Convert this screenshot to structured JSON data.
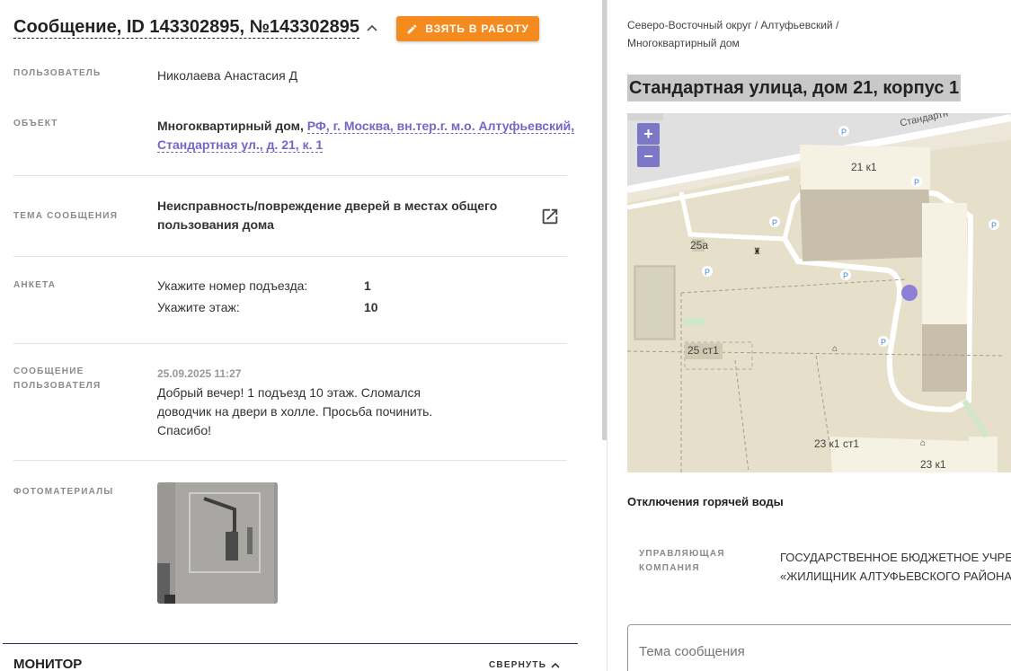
{
  "header": {
    "title": "Сообщение, ID 143302895, №143302895",
    "take_button_label": "ВЗЯТЬ В РАБОТУ"
  },
  "fields": {
    "user": {
      "label": "ПОЛЬЗОВАТЕЛЬ",
      "value": "Николаева Анастасия Д"
    },
    "object": {
      "label": "ОБЪЕКТ",
      "type": "Многоквартирный дом,",
      "address_line1": "РФ, г. Москва, вн.тер.г. м.о. Алтуфьевский,",
      "address_line2": "Стандартная ул., д. 21, к. 1"
    },
    "topic": {
      "label": "ТЕМА СООБЩЕНИЯ",
      "line1": "Неисправность/повреждение дверей в местах общего",
      "line2": "пользования дома"
    },
    "survey": {
      "label": "АНКЕТА",
      "rows": [
        {
          "q": "Укажите номер подъезда:",
          "a": "1"
        },
        {
          "q": "Укажите этаж:",
          "a": "10"
        }
      ]
    },
    "message": {
      "label_line1": "СООБЩЕНИЕ",
      "label_line2": "ПОЛЬЗОВАТЕЛЯ",
      "date": "25.09.2025 11:27",
      "line1": "Добрый вечер! 1 подъезд 10 этаж. Сломался",
      "line2": "доводчик на двери в холле. Просьба починить.",
      "line3": "Спасибо!"
    },
    "photos": {
      "label": "ФОТОМАТЕРИАЛЫ"
    }
  },
  "monitor": {
    "title": "МОНИТОР",
    "collapse_label": "СВЕРНУТЬ"
  },
  "right": {
    "breadcrumb_line1": "Северо-Восточный округ / Алтуфьевский /",
    "breadcrumb_line2": "Многоквартирный дом",
    "address": "Стандартная улица, дом 21, корпус 1",
    "map": {
      "zoom_in": "+",
      "zoom_out": "−",
      "street": "Стандартн",
      "labels": [
        "21 к1",
        "25а",
        "25 ст1",
        "23 к1 ст1",
        "23 к1"
      ],
      "parking": "P"
    },
    "hot_water_title": "Отключения горячей воды",
    "management": {
      "label_line1": "УПРАВЛЯЮЩАЯ",
      "label_line2": "КОМПАНИЯ",
      "line1": "ГОСУДАРСТВЕННОЕ БЮДЖЕТНОЕ УЧРЕ",
      "line2": "«ЖИЛИЩНИК АЛТУФЬЕВСКОГО РАЙОНА"
    },
    "topic_input_placeholder": "Тема сообщения"
  }
}
